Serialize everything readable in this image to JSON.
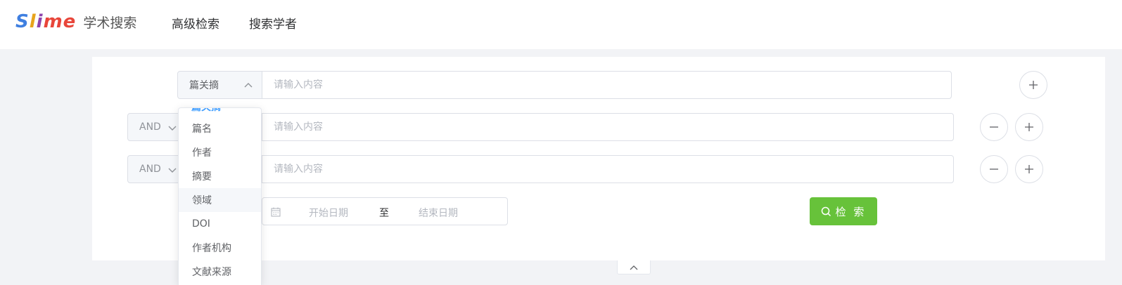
{
  "header": {
    "logo_word": "Slime",
    "logo_colors": [
      "#3f7fe0",
      "#e8a41c",
      "#8e44ad",
      "#e8463a",
      "#e8463a"
    ],
    "site_name": "学术搜索",
    "nav": [
      {
        "label": "高级检索"
      },
      {
        "label": "搜索学者"
      }
    ]
  },
  "search": {
    "rows": [
      {
        "field": "篇关摘",
        "placeholder": "请输入内容"
      },
      {
        "logic": "AND",
        "placeholder": "请输入内容"
      },
      {
        "logic": "AND",
        "placeholder": "请输入内容"
      }
    ],
    "date_range": {
      "start_placeholder": "开始日期",
      "separator": "至",
      "end_placeholder": "结束日期"
    },
    "search_button": "检 索",
    "search_button_color": "#67c23a"
  },
  "field_dropdown": {
    "partial_item": "篇关摘",
    "items": [
      "篇名",
      "作者",
      "摘要",
      "领域",
      "DOI",
      "作者机构",
      "文献来源"
    ],
    "hovered": "领域"
  },
  "icons": {
    "add": "plus-icon",
    "remove": "minus-icon",
    "calendar": "calendar-icon",
    "search": "search-icon",
    "collapse": "chevron-up-icon"
  }
}
